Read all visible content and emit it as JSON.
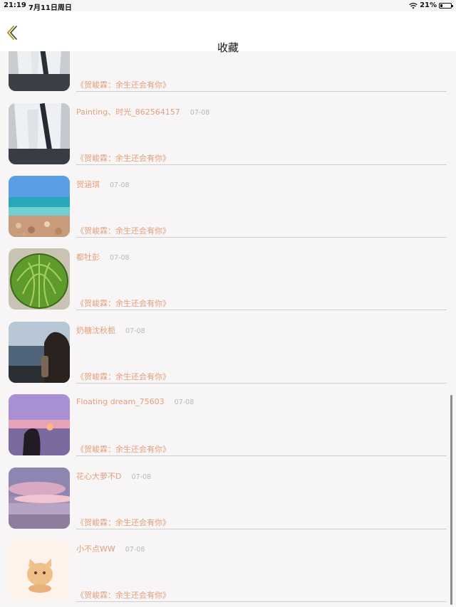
{
  "status_bar": {
    "time": "21:19",
    "date": "7月11日周日",
    "battery": "21%"
  },
  "nav": {
    "title": "收藏",
    "back_icon": "chevron-left-icon",
    "accent_color": "#b0991f"
  },
  "items": [
    {
      "name": "",
      "date": "",
      "quote": "《贺峻霖：余生还会有你》",
      "image": "schoolgirl-uniform"
    },
    {
      "name": "Painting、时光_862564157",
      "date": "07-08",
      "quote": "《贺峻霖：余生还会有你》",
      "image": "schoolgirl-uniform"
    },
    {
      "name": "贺涵琪",
      "date": "07-08",
      "quote": "《贺峻霖：余生还会有你》",
      "image": "beach-sea"
    },
    {
      "name": "都牡彭",
      "date": "07-08",
      "quote": "《贺峻霖：余生还会有你》",
      "image": "cactus"
    },
    {
      "name": "奶糖沈秋栀",
      "date": "07-08",
      "quote": "《贺峻霖：余生还会有你》",
      "image": "girl-sunset-sea"
    },
    {
      "name": "Floating dream_75603",
      "date": "07-08",
      "quote": "《贺峻霖：余生还会有你》",
      "image": "pink-sunset-silhouette"
    },
    {
      "name": "花心大萝不D",
      "date": "07-08",
      "quote": "《贺峻霖：余生还会有你》",
      "image": "pink-clouds-beach"
    },
    {
      "name": "小不点WW",
      "date": "07-08",
      "quote": "《贺峻霖：余生还会有你》",
      "image": "cartoon-kitten"
    }
  ]
}
